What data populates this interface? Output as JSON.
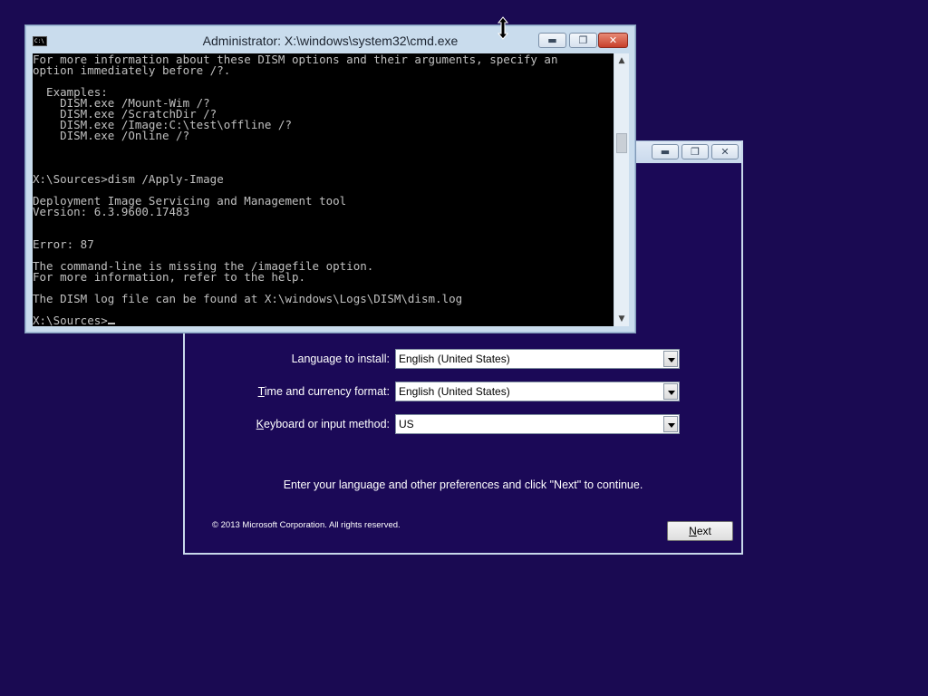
{
  "desktop": {
    "background": "#1a0a52"
  },
  "setup": {
    "language_label_pre": "Language to install",
    "language_label_post": ":",
    "language_value": "English (United States)",
    "time_label_pre": "",
    "time_label_key": "T",
    "time_label_post": "ime and currency format:",
    "time_value": "English (United States)",
    "keyboard_label_key": "K",
    "keyboard_label_post": "eyboard or input method:",
    "keyboard_value": "US",
    "instruction": "Enter your language and other preferences and click \"Next\" to continue.",
    "copyright": "© 2013 Microsoft Corporation. All rights reserved.",
    "next_key": "N",
    "next_rest": "ext"
  },
  "cmd": {
    "title": "Administrator: X:\\windows\\system32\\cmd.exe",
    "icon_text": "C:\\",
    "lines": "For more information about these DISM options and their arguments, specify an\noption immediately before /?.\n\n  Examples:\n    DISM.exe /Mount-Wim /?\n    DISM.exe /ScratchDir /?\n    DISM.exe /Image:C:\\test\\offline /?\n    DISM.exe /Online /?\n\n\n\nX:\\Sources>dism /Apply-Image\n\nDeployment Image Servicing and Management tool\nVersion: 6.3.9600.17483\n\n\nError: 87\n\nThe command-line is missing the /imagefile option.\nFor more information, refer to the help.\n\nThe DISM log file can be found at X:\\windows\\Logs\\DISM\\dism.log\n\n",
    "prompt": "X:\\Sources>"
  }
}
